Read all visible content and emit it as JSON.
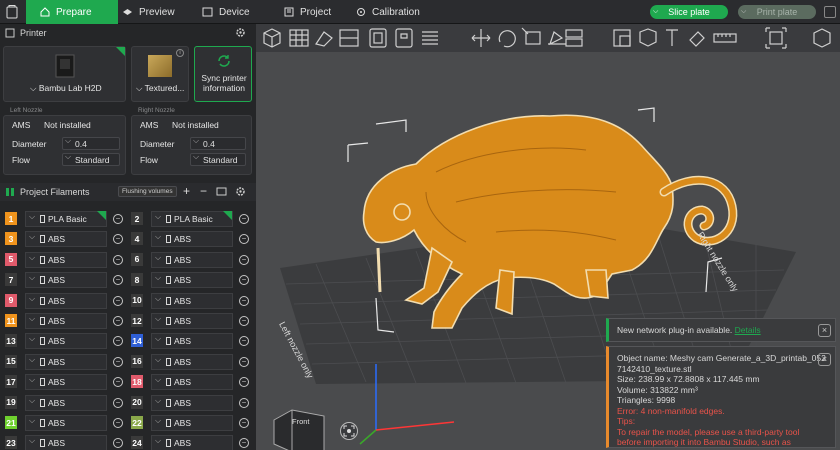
{
  "topbar": {
    "prepare": "Prepare",
    "preview": "Preview",
    "device": "Device",
    "project": "Project",
    "calibration": "Calibration",
    "slice_plate": "Slice plate",
    "print_plate": "Print plate"
  },
  "printer": {
    "header": "Printer",
    "model": "Bambu Lab H2D",
    "plate": "Textured...",
    "sync": "Sync printer information",
    "left_nozzle": "Left Nozzle",
    "right_nozzle": "Right Nozzle",
    "ams_label": "AMS",
    "ams_value": "Not installed",
    "diameter_label": "Diameter",
    "diameter_value": "0.4",
    "flow_label": "Flow",
    "flow_value": "Standard"
  },
  "filaments": {
    "header": "Project Filaments",
    "flushing": "Flushing volumes",
    "rows": [
      {
        "l": {
          "n": "1",
          "name": "PLA Basic",
          "c": "#f0941d"
        },
        "r": {
          "n": "2",
          "name": "PLA Basic",
          "c": "#3a3a3a"
        }
      },
      {
        "l": {
          "n": "3",
          "name": "ABS",
          "c": "#f0941d"
        },
        "r": {
          "n": "4",
          "name": "ABS",
          "c": "#3a3a3a"
        }
      },
      {
        "l": {
          "n": "5",
          "name": "ABS",
          "c": "#e05a6b"
        },
        "r": {
          "n": "6",
          "name": "ABS",
          "c": "#3a3a3a"
        }
      },
      {
        "l": {
          "n": "7",
          "name": "ABS",
          "c": "#3a3a3a"
        },
        "r": {
          "n": "8",
          "name": "ABS",
          "c": "#3a3a3a"
        }
      },
      {
        "l": {
          "n": "9",
          "name": "ABS",
          "c": "#e05a6b"
        },
        "r": {
          "n": "10",
          "name": "ABS",
          "c": "#3a3a3a"
        }
      },
      {
        "l": {
          "n": "11",
          "name": "ABS",
          "c": "#f0941d"
        },
        "r": {
          "n": "12",
          "name": "ABS",
          "c": "#3a3a3a"
        }
      },
      {
        "l": {
          "n": "13",
          "name": "ABS",
          "c": "#3a3a3a"
        },
        "r": {
          "n": "14",
          "name": "ABS",
          "c": "#2f5fd6"
        }
      },
      {
        "l": {
          "n": "15",
          "name": "ABS",
          "c": "#3a3a3a"
        },
        "r": {
          "n": "16",
          "name": "ABS",
          "c": "#3a3a3a"
        }
      },
      {
        "l": {
          "n": "17",
          "name": "ABS",
          "c": "#3a3a3a"
        },
        "r": {
          "n": "18",
          "name": "ABS",
          "c": "#e05a6b"
        }
      },
      {
        "l": {
          "n": "19",
          "name": "ABS",
          "c": "#3a3a3a"
        },
        "r": {
          "n": "20",
          "name": "ABS",
          "c": "#3a3a3a"
        }
      },
      {
        "l": {
          "n": "21",
          "name": "ABS",
          "c": "#6fd12f"
        },
        "r": {
          "n": "22",
          "name": "ABS",
          "c": "#8aa84a"
        }
      },
      {
        "l": {
          "n": "23",
          "name": "ABS",
          "c": "#3a3a3a"
        },
        "r": {
          "n": "24",
          "name": "ABS",
          "c": "#3a3a3a"
        }
      }
    ]
  },
  "viewport": {
    "left_nozzle_only": "Left nozzle only",
    "right_nozzle_only": "Right nozzle only",
    "cube_label": "Front"
  },
  "notices": {
    "plugin": "New network plug-in available.",
    "plugin_link": "Details",
    "info_lines": [
      "Object name: Meshy cam Generate_a_3D_printab_052",
      "7142410_texture.stl",
      "Size: 238.99 x 72.8808 x 117.445 mm",
      "Volume: 313822 mm³",
      "Triangles: 9998"
    ],
    "error_lines": [
      "Error: 4 non-manifold edges.",
      "Tips:",
      "To repair the model, please use a third-party tool",
      "before importing it into Bambu Studio, such as"
    ],
    "repair_link": "https://www.formware.co/onlinestlrepair."
  },
  "colors": {
    "accent": "#1fa94f",
    "model": "#d98b1a",
    "error": "#e8534a",
    "link": "#1fa94f"
  }
}
